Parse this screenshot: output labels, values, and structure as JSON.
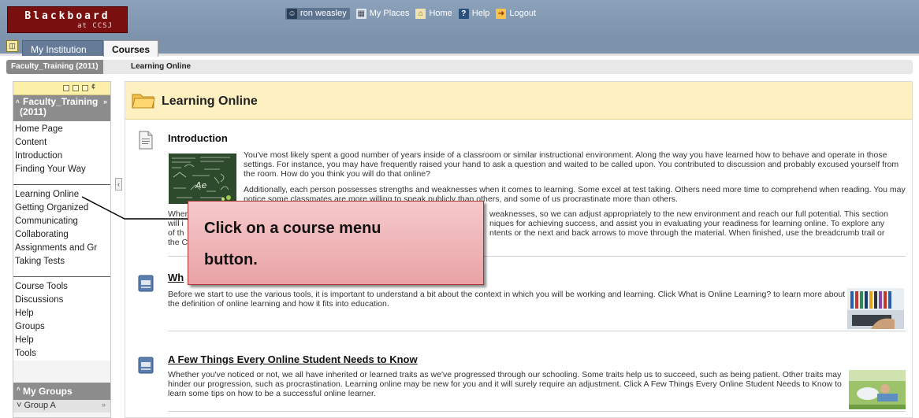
{
  "header": {
    "logo_line1": "Blackboard",
    "logo_line2": "at CCSJ",
    "nav": [
      {
        "label": "ron weasley",
        "icon": "user-icon"
      },
      {
        "label": "My Places",
        "icon": "places-icon"
      },
      {
        "label": "Home",
        "icon": "home-icon"
      },
      {
        "label": "Help",
        "icon": "help-icon"
      },
      {
        "label": "Logout",
        "icon": "logout-icon"
      }
    ]
  },
  "tabs": {
    "institution": "My Institution",
    "courses": "Courses"
  },
  "breadcrumb": {
    "course": "Faculty_Training (2011)",
    "current": "Learning Online"
  },
  "course_menu": {
    "title_line1": "Faculty_Training",
    "title_line2": "(2011)",
    "group1": [
      "Home Page",
      "Content",
      "Introduction",
      "Finding Your Way"
    ],
    "group2": [
      "Learning Online",
      "Getting Organized",
      "Communicating",
      "Collaborating",
      "Assignments and Gr",
      "Taking Tests"
    ],
    "group3": [
      "Course Tools",
      "Discussions",
      "Help",
      "Groups",
      "Help",
      "Tools"
    ],
    "my_groups_label": "My Groups",
    "group_a": "Group A"
  },
  "content": {
    "page_title": "Learning Online",
    "items": [
      {
        "title": "Introduction",
        "p1": "You've most likely spent a good number of years inside of a classroom or similar instructional environment. Along the way you have learned how to behave and operate in those settings. For instance, you may have frequently raised your hand to ask a question and waited to be called upon. You contributed to discussion and probably excused yourself from the room. How do you think you will do that online?",
        "p2": "Additionally, each person possesses strengths and weaknesses when it comes to learning. Some excel at test taking. Others need more time to comprehend when reading. You may notice some classmates are more willing to speak publicly than others, and some of us procrastinate more than others.",
        "p3a": "When",
        "p3b": "weaknesses, so we can adjust appropriately to the new environment and reach our full potential. This section",
        "p3c": "will i",
        "p3d": "niques for achieving success, and assist you in evaluating your readiness for learning online. To explore any",
        "p3e": "of th",
        "p3f": "ntents or the next and back arrows to move through the material. When finished, use the breadcrumb trail or",
        "p3g": "the C"
      },
      {
        "title": "Wh",
        "body": "Before we start to use the various tools, it is important to understand a bit about the context in which you will be working and learning. Click What is Online Learning? to learn more about the definition of online learning and how it fits into education."
      },
      {
        "title": "A Few Things Every Online Student Needs to Know",
        "body": "Whether you've noticed or not, we all have inherited or learned traits as we've progressed through our schooling. Some traits help us to succeed, such as being patient. Other traits may hinder our progression, such as procrastination. Learning online may be new for you and it will surely require an adjustment. Click A Few Things Every Online Student Needs to Know to learn some tips on how to be a successful online learner."
      }
    ]
  },
  "callout": {
    "line1": "Click on a course menu",
    "line2": "button."
  },
  "colors": {
    "header_bg": "#7d93ac",
    "logo_bg": "#7a0f0f",
    "content_head_bg": "#fff0c2",
    "callout_bg": "#efb5b8"
  }
}
